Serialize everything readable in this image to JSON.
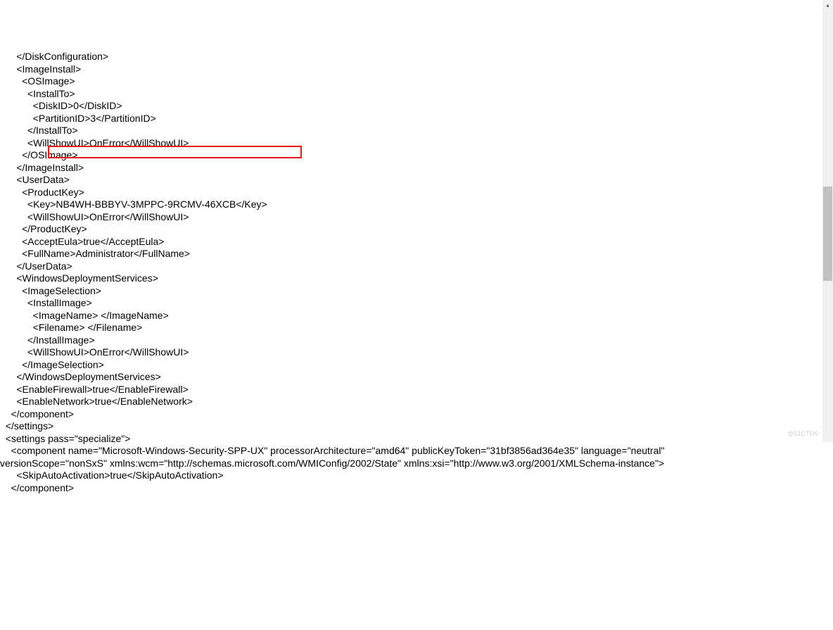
{
  "lines": [
    "      </DiskConfiguration>",
    "      <ImageInstall>",
    "        <OSImage>",
    "          <InstallTo>",
    "            <DiskID>0</DiskID>",
    "            <PartitionID>3</PartitionID>",
    "          </InstallTo>",
    "          <WillShowUI>OnError</WillShowUI>",
    "        </OSImage>",
    "      </ImageInstall>",
    "      <UserData>",
    "        <ProductKey>",
    "          <Key>NB4WH-BBBYV-3MPPC-9RCMV-46XCB</Key>",
    "          <WillShowUI>OnError</WillShowUI>",
    "        </ProductKey>",
    "        <AcceptEula>true</AcceptEula>",
    "        <FullName>Administrator</FullName>",
    "      </UserData>",
    "      <WindowsDeploymentServices>",
    "        <ImageSelection>",
    "          <InstallImage>",
    "            <ImageName> </ImageName>",
    "            <Filename> </Filename>",
    "          </InstallImage>",
    "          <WillShowUI>OnError</WillShowUI>",
    "        </ImageSelection>",
    "      </WindowsDeploymentServices>",
    "      <EnableFirewall>true</EnableFirewall>",
    "      <EnableNetwork>true</EnableNetwork>",
    "    </component>",
    "  </settings>",
    "  <settings pass=\"specialize\">",
    "    <component name=\"Microsoft-Windows-Security-SPP-UX\" processorArchitecture=\"amd64\" publicKeyToken=\"31bf3856ad364e35\" language=\"neutral\" versionScope=\"nonSxS\" xmlns:wcm=\"http://schemas.microsoft.com/WMIConfig/2002/State\" xmlns:xsi=\"http://www.w3.org/2001/XMLSchema-instance\">",
    "      <SkipAutoActivation>true</SkipAutoActivation>",
    "    </component>"
  ],
  "watermark": "@51CTO©"
}
